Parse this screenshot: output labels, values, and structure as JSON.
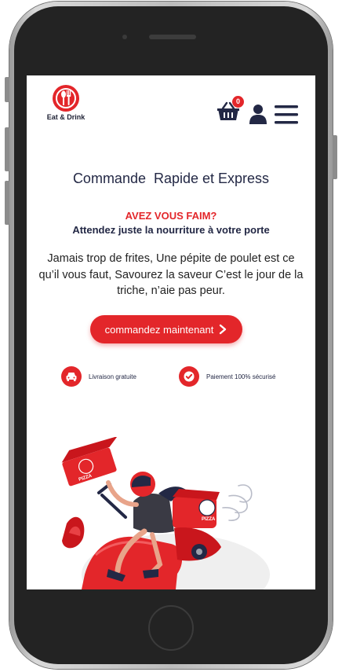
{
  "header": {
    "logo_text": "Eat & Drink",
    "cart_count": "0"
  },
  "hero": {
    "tagline": "Commande  Rapide et Express",
    "hungry": "AVEZ VOUS FAIM?",
    "subtitle": "Attendez juste la nourriture à votre porte",
    "description": "Jamais trop de frites, Une pépite de poulet est ce qu’il vous faut, Savourez la saveur C’est le jour de la triche, n’aie pas peur.",
    "cta_label": "commandez maintenant"
  },
  "features": [
    {
      "icon": "car-icon",
      "label": "Livraison gratuite"
    },
    {
      "icon": "check-icon",
      "label": "Paiement 100% sécurisé"
    }
  ],
  "illustration": {
    "box_text": "PIZZA",
    "scooter_text": "PIZZA"
  },
  "colors": {
    "accent": "#e3262a",
    "text_dark": "#232845",
    "phone_frame": "#232323"
  }
}
